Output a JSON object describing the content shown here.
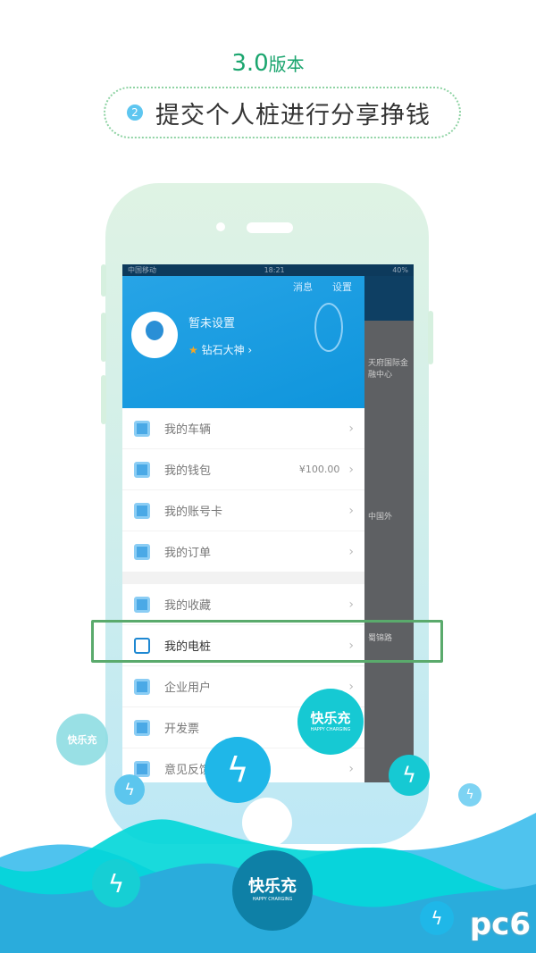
{
  "header": {
    "version": "3.0",
    "version_suffix": "版本",
    "step_number": "2",
    "slogan": "提交个人桩进行分享挣钱"
  },
  "status_bar": {
    "carrier": "中国移动",
    "time": "18:21",
    "battery": "40%"
  },
  "drawer": {
    "messages": "消息",
    "settings": "设置",
    "username": "暂未设置",
    "level": "钻石大神",
    "items": [
      {
        "label": "我的车辆",
        "icon": "car-icon"
      },
      {
        "label": "我的钱包",
        "value": "¥100.00",
        "icon": "wallet-icon"
      },
      {
        "label": "我的账号卡",
        "icon": "card-icon"
      },
      {
        "label": "我的订单",
        "icon": "order-icon"
      },
      {
        "label": "我的收藏",
        "icon": "heart-icon"
      },
      {
        "label": "我的电桩",
        "icon": "charger-icon",
        "highlighted": true
      },
      {
        "label": "企业用户",
        "icon": "edit-icon"
      },
      {
        "label": "开发票",
        "icon": "invoice-icon"
      },
      {
        "label": "意见反馈",
        "icon": "feedback-icon"
      }
    ]
  },
  "map": {
    "poi_1": "天府国际金融中心",
    "poi_2": "中国外",
    "road": "蜀锦路"
  },
  "brand": {
    "name": "快乐充",
    "tagline": "HAPPY CHARGING",
    "accent": "#16c9d3",
    "highlight": "#5aaa6c"
  },
  "watermark": "pc6"
}
